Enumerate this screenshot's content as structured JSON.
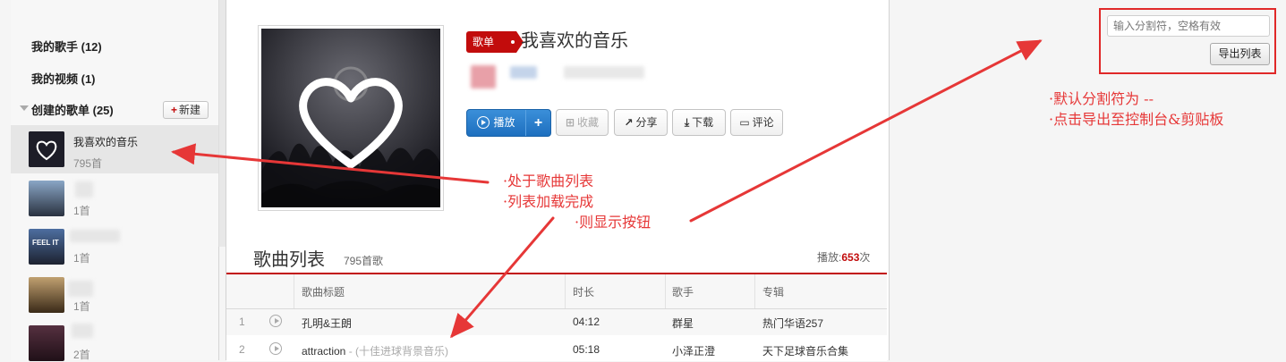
{
  "sidebar": {
    "my_singers": "我的歌手 (12)",
    "my_videos": "我的视频 (1)",
    "created_playlists": "创建的歌单 (25)",
    "new_button_label": "新建",
    "playlists": [
      {
        "name": "我喜欢的音乐",
        "count": "795首",
        "active": true
      },
      {
        "name": "",
        "count": "1首"
      },
      {
        "name": "",
        "count": "1首"
      },
      {
        "name": "",
        "count": "1首"
      },
      {
        "name": "",
        "count": "2首"
      }
    ]
  },
  "playlist": {
    "tag": "歌单",
    "title": "我喜欢的音乐",
    "actions": {
      "play": "播放",
      "add": "+",
      "collect": "收藏",
      "share": "分享",
      "download": "下载",
      "comment": "评论"
    }
  },
  "song_list": {
    "title": "歌曲列表",
    "count": "795首歌",
    "play_label": "播放:",
    "play_count": "653",
    "play_unit": "次",
    "headers": [
      "歌曲标题",
      "时长",
      "歌手",
      "专辑"
    ],
    "songs": [
      {
        "no": "1",
        "title": "孔明&王朗",
        "subtitle": "",
        "duration": "04:12",
        "artist": "群星",
        "album": "热门华语257"
      },
      {
        "no": "2",
        "title": "attraction",
        "subtitle": " - (十佳进球背景音乐)",
        "duration": "05:18",
        "artist": "小泽正澄",
        "album": "天下足球音乐合集"
      }
    ]
  },
  "export_widget": {
    "placeholder": "输入分割符，空格有效",
    "button_label": "导出列表"
  },
  "annotations": {
    "left": [
      "·处于歌曲列表",
      "·列表加载完成",
      "·则显示按钮"
    ],
    "right": [
      "·默认分割符为 --",
      "·点击导出至控制台&剪贴板"
    ]
  },
  "colors": {
    "accent_red": "#c20c0c",
    "play_blue": "#2575c5",
    "annotation_red": "#e63737"
  }
}
